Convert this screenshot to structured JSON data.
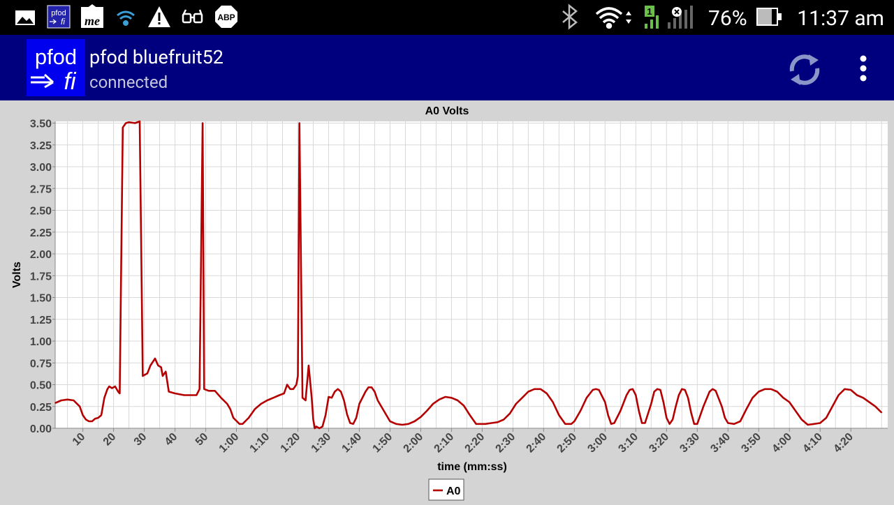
{
  "status_bar": {
    "battery_percent": "76%",
    "time": "11:37 am",
    "signal_sim": "1",
    "icons_left": [
      "gallery-icon",
      "pfodfi-notification-icon",
      "me-app-icon",
      "wifi-icon",
      "warning-icon",
      "glasses-icon",
      "abp-icon"
    ],
    "icons_right": [
      "bluetooth-icon",
      "wifi-icon",
      "signal-icon",
      "battery-icon"
    ],
    "abp_text": "ABP",
    "pfod_small_top": "pfod",
    "pfod_small_bottom": "fi",
    "me_text": "me"
  },
  "app_bar": {
    "logo_top": "pfod",
    "logo_bottom": "fi",
    "title": "pfod bluefruit52",
    "subtitle": "connected",
    "colors": {
      "bar": "#00007f",
      "logo": "#0000ee"
    }
  },
  "chart_data": {
    "type": "line",
    "title": "A0 Volts",
    "xlabel": "time (mm:ss)",
    "ylabel": "Volts",
    "x_unit": "seconds",
    "xlim": [
      1,
      272
    ],
    "ylim": [
      0,
      3.52
    ],
    "x_ticks": [
      {
        "t": 10,
        "label": "10"
      },
      {
        "t": 20,
        "label": "20"
      },
      {
        "t": 30,
        "label": "30"
      },
      {
        "t": 40,
        "label": "40"
      },
      {
        "t": 50,
        "label": "50"
      },
      {
        "t": 60,
        "label": "1:00"
      },
      {
        "t": 70,
        "label": "1:10"
      },
      {
        "t": 80,
        "label": "1:20"
      },
      {
        "t": 90,
        "label": "1:30"
      },
      {
        "t": 100,
        "label": "1:40"
      },
      {
        "t": 110,
        "label": "1:50"
      },
      {
        "t": 120,
        "label": "2:00"
      },
      {
        "t": 130,
        "label": "2:10"
      },
      {
        "t": 140,
        "label": "2:20"
      },
      {
        "t": 150,
        "label": "2:30"
      },
      {
        "t": 160,
        "label": "2:40"
      },
      {
        "t": 170,
        "label": "2:50"
      },
      {
        "t": 180,
        "label": "3:00"
      },
      {
        "t": 190,
        "label": "3:10"
      },
      {
        "t": 200,
        "label": "3:20"
      },
      {
        "t": 210,
        "label": "3:30"
      },
      {
        "t": 220,
        "label": "3:40"
      },
      {
        "t": 230,
        "label": "3:50"
      },
      {
        "t": 240,
        "label": "4:00"
      },
      {
        "t": 250,
        "label": "4:10"
      },
      {
        "t": 260,
        "label": "4:20"
      }
    ],
    "y_ticks": [
      0,
      0.25,
      0.5,
      0.75,
      1.0,
      1.25,
      1.5,
      1.75,
      2.0,
      2.25,
      2.5,
      2.75,
      3.0,
      3.25,
      3.5
    ],
    "y_tick_labels": [
      "0.00",
      "0.25",
      "0.50",
      "0.75",
      "1.00",
      "1.25",
      "1.50",
      "1.75",
      "2.00",
      "2.25",
      "2.50",
      "2.75",
      "3.00",
      "3.25",
      "3.50"
    ],
    "grid": true,
    "legend_position": "bottom-center",
    "series": [
      {
        "name": "A0",
        "color": "#b40000",
        "points": [
          [
            1,
            0.29
          ],
          [
            3,
            0.32
          ],
          [
            5,
            0.33
          ],
          [
            7,
            0.32
          ],
          [
            9,
            0.25
          ],
          [
            10,
            0.15
          ],
          [
            11,
            0.1
          ],
          [
            12,
            0.08
          ],
          [
            13,
            0.08
          ],
          [
            14,
            0.11
          ],
          [
            15,
            0.12
          ],
          [
            16,
            0.15
          ],
          [
            17,
            0.35
          ],
          [
            18,
            0.45
          ],
          [
            18.6,
            0.48
          ],
          [
            19.5,
            0.46
          ],
          [
            20.5,
            0.48
          ],
          [
            21.5,
            0.42
          ],
          [
            22,
            0.4
          ],
          [
            23,
            3.45
          ],
          [
            24,
            3.5
          ],
          [
            25,
            3.51
          ],
          [
            27,
            3.5
          ],
          [
            28.5,
            3.52
          ],
          [
            29.5,
            0.6
          ],
          [
            30.5,
            0.62
          ],
          [
            31,
            0.63
          ],
          [
            32,
            0.72
          ],
          [
            33.5,
            0.8
          ],
          [
            34.5,
            0.72
          ],
          [
            35.5,
            0.7
          ],
          [
            36,
            0.6
          ],
          [
            37,
            0.65
          ],
          [
            38,
            0.42
          ],
          [
            40,
            0.4
          ],
          [
            43,
            0.38
          ],
          [
            47,
            0.38
          ],
          [
            48,
            0.45
          ],
          [
            49,
            3.5
          ],
          [
            49.5,
            0.45
          ],
          [
            51,
            0.43
          ],
          [
            53,
            0.43
          ],
          [
            55,
            0.35
          ],
          [
            57,
            0.28
          ],
          [
            58,
            0.22
          ],
          [
            59,
            0.12
          ],
          [
            61,
            0.05
          ],
          [
            62,
            0.05
          ],
          [
            64,
            0.12
          ],
          [
            66,
            0.22
          ],
          [
            68,
            0.28
          ],
          [
            70,
            0.32
          ],
          [
            72,
            0.35
          ],
          [
            74,
            0.38
          ],
          [
            75.5,
            0.4
          ],
          [
            76.5,
            0.5
          ],
          [
            77.5,
            0.45
          ],
          [
            78.5,
            0.45
          ],
          [
            79.5,
            0.5
          ],
          [
            80,
            0.6
          ],
          [
            80.5,
            3.5
          ],
          [
            81.5,
            0.35
          ],
          [
            82.5,
            0.32
          ],
          [
            83.5,
            0.72
          ],
          [
            84.5,
            0.35
          ],
          [
            85,
            0.1
          ],
          [
            85.5,
            0.0
          ],
          [
            86,
            0.02
          ],
          [
            87,
            0.0
          ],
          [
            88,
            0.02
          ],
          [
            89,
            0.15
          ],
          [
            90,
            0.36
          ],
          [
            91,
            0.35
          ],
          [
            92,
            0.42
          ],
          [
            93,
            0.45
          ],
          [
            94,
            0.42
          ],
          [
            95,
            0.32
          ],
          [
            96,
            0.16
          ],
          [
            97,
            0.06
          ],
          [
            98,
            0.05
          ],
          [
            99,
            0.12
          ],
          [
            100,
            0.28
          ],
          [
            102,
            0.42
          ],
          [
            103,
            0.47
          ],
          [
            104,
            0.47
          ],
          [
            105,
            0.42
          ],
          [
            106,
            0.32
          ],
          [
            108,
            0.2
          ],
          [
            110,
            0.08
          ],
          [
            112,
            0.05
          ],
          [
            114,
            0.04
          ],
          [
            116,
            0.05
          ],
          [
            118,
            0.08
          ],
          [
            120,
            0.13
          ],
          [
            122,
            0.2
          ],
          [
            124,
            0.28
          ],
          [
            126,
            0.33
          ],
          [
            128,
            0.36
          ],
          [
            130,
            0.35
          ],
          [
            132,
            0.32
          ],
          [
            134,
            0.26
          ],
          [
            136,
            0.15
          ],
          [
            138,
            0.05
          ],
          [
            141,
            0.05
          ],
          [
            143,
            0.06
          ],
          [
            145,
            0.07
          ],
          [
            147,
            0.1
          ],
          [
            149,
            0.17
          ],
          [
            151,
            0.28
          ],
          [
            153,
            0.35
          ],
          [
            155,
            0.42
          ],
          [
            157,
            0.45
          ],
          [
            159,
            0.45
          ],
          [
            161,
            0.4
          ],
          [
            163,
            0.3
          ],
          [
            165,
            0.15
          ],
          [
            167,
            0.05
          ],
          [
            169,
            0.05
          ],
          [
            170,
            0.08
          ],
          [
            172,
            0.2
          ],
          [
            174,
            0.35
          ],
          [
            176,
            0.44
          ],
          [
            177,
            0.45
          ],
          [
            178,
            0.44
          ],
          [
            180,
            0.3
          ],
          [
            181,
            0.15
          ],
          [
            182,
            0.05
          ],
          [
            183,
            0.06
          ],
          [
            185,
            0.2
          ],
          [
            187,
            0.38
          ],
          [
            188,
            0.44
          ],
          [
            189,
            0.45
          ],
          [
            190,
            0.38
          ],
          [
            191,
            0.2
          ],
          [
            192,
            0.06
          ],
          [
            193,
            0.06
          ],
          [
            195,
            0.28
          ],
          [
            196,
            0.42
          ],
          [
            197,
            0.45
          ],
          [
            198,
            0.44
          ],
          [
            199,
            0.3
          ],
          [
            200,
            0.12
          ],
          [
            201,
            0.05
          ],
          [
            202,
            0.1
          ],
          [
            203,
            0.25
          ],
          [
            204,
            0.38
          ],
          [
            205,
            0.45
          ],
          [
            206,
            0.44
          ],
          [
            207,
            0.35
          ],
          [
            208,
            0.18
          ],
          [
            209,
            0.05
          ],
          [
            210,
            0.05
          ],
          [
            212,
            0.25
          ],
          [
            214,
            0.42
          ],
          [
            215,
            0.45
          ],
          [
            216,
            0.43
          ],
          [
            218,
            0.25
          ],
          [
            219,
            0.12
          ],
          [
            220,
            0.06
          ],
          [
            222,
            0.05
          ],
          [
            224,
            0.08
          ],
          [
            226,
            0.22
          ],
          [
            228,
            0.35
          ],
          [
            230,
            0.42
          ],
          [
            232,
            0.45
          ],
          [
            234,
            0.45
          ],
          [
            236,
            0.42
          ],
          [
            238,
            0.35
          ],
          [
            240,
            0.3
          ],
          [
            242,
            0.2
          ],
          [
            244,
            0.1
          ],
          [
            246,
            0.04
          ],
          [
            248,
            0.05
          ],
          [
            250,
            0.06
          ],
          [
            252,
            0.12
          ],
          [
            254,
            0.25
          ],
          [
            256,
            0.38
          ],
          [
            258,
            0.45
          ],
          [
            260,
            0.44
          ],
          [
            262,
            0.38
          ],
          [
            264,
            0.35
          ],
          [
            266,
            0.3
          ],
          [
            268,
            0.25
          ],
          [
            270,
            0.18
          ]
        ]
      }
    ]
  }
}
